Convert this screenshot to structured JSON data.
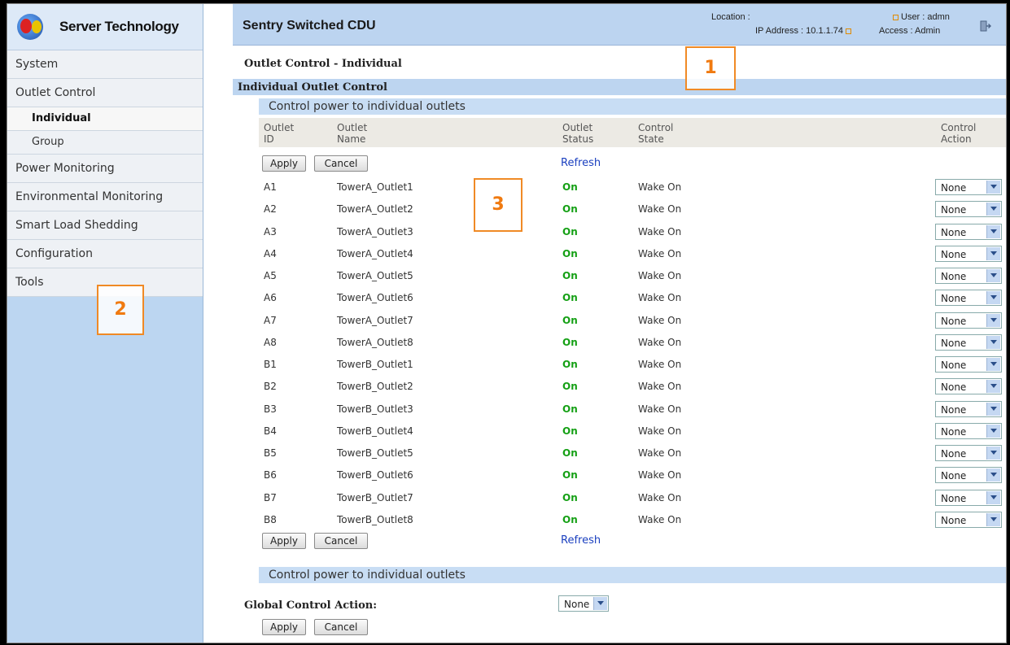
{
  "brand": {
    "name": "Server Technology"
  },
  "nav": {
    "system": "System",
    "outlet_control": "Outlet Control",
    "individual": "Individual",
    "group": "Group",
    "power_monitoring": "Power Monitoring",
    "environmental_monitoring": "Environmental Monitoring",
    "smart_load_shedding": "Smart Load Shedding",
    "configuration": "Configuration",
    "tools": "Tools"
  },
  "header": {
    "title": "Sentry Switched CDU",
    "location_label": "Location :",
    "ip_label": "IP Address : 10.1.1.74",
    "user_label": "User : admn",
    "access_label": "Access : Admin"
  },
  "main": {
    "page_title": "Outlet Control - Individual",
    "section_title": "Individual Outlet Control",
    "subsection": "Control power to individual outlets",
    "columns": {
      "outlet_id_1": "Outlet",
      "outlet_id_2": "ID",
      "outlet_name_1": "Outlet",
      "outlet_name_2": "Name",
      "status_1": "Outlet",
      "status_2": "Status",
      "state_1": "Control",
      "state_2": "State",
      "action_1": "Control",
      "action_2": "Action"
    },
    "apply": "Apply",
    "cancel": "Cancel",
    "refresh": "Refresh",
    "global_label": "Global Control Action:",
    "global_value": "None",
    "subsection2": "Control power to individual outlets"
  },
  "outlets": [
    {
      "id": "A1",
      "name": "TowerA_Outlet1",
      "status": "On",
      "state": "Wake On",
      "action": "None"
    },
    {
      "id": "A2",
      "name": "TowerA_Outlet2",
      "status": "On",
      "state": "Wake On",
      "action": "None"
    },
    {
      "id": "A3",
      "name": "TowerA_Outlet3",
      "status": "On",
      "state": "Wake On",
      "action": "None"
    },
    {
      "id": "A4",
      "name": "TowerA_Outlet4",
      "status": "On",
      "state": "Wake On",
      "action": "None"
    },
    {
      "id": "A5",
      "name": "TowerA_Outlet5",
      "status": "On",
      "state": "Wake On",
      "action": "None"
    },
    {
      "id": "A6",
      "name": "TowerA_Outlet6",
      "status": "On",
      "state": "Wake On",
      "action": "None"
    },
    {
      "id": "A7",
      "name": "TowerA_Outlet7",
      "status": "On",
      "state": "Wake On",
      "action": "None"
    },
    {
      "id": "A8",
      "name": "TowerA_Outlet8",
      "status": "On",
      "state": "Wake On",
      "action": "None"
    },
    {
      "id": "B1",
      "name": "TowerB_Outlet1",
      "status": "On",
      "state": "Wake On",
      "action": "None"
    },
    {
      "id": "B2",
      "name": "TowerB_Outlet2",
      "status": "On",
      "state": "Wake On",
      "action": "None"
    },
    {
      "id": "B3",
      "name": "TowerB_Outlet3",
      "status": "On",
      "state": "Wake On",
      "action": "None"
    },
    {
      "id": "B4",
      "name": "TowerB_Outlet4",
      "status": "On",
      "state": "Wake On",
      "action": "None"
    },
    {
      "id": "B5",
      "name": "TowerB_Outlet5",
      "status": "On",
      "state": "Wake On",
      "action": "None"
    },
    {
      "id": "B6",
      "name": "TowerB_Outlet6",
      "status": "On",
      "state": "Wake On",
      "action": "None"
    },
    {
      "id": "B7",
      "name": "TowerB_Outlet7",
      "status": "On",
      "state": "Wake On",
      "action": "None"
    },
    {
      "id": "B8",
      "name": "TowerB_Outlet8",
      "status": "On",
      "state": "Wake On",
      "action": "None"
    }
  ],
  "markers": {
    "m1": "1",
    "m2": "2",
    "m3": "3"
  },
  "colors": {
    "accent": "#f08a25",
    "status_on": "#15a015",
    "link": "#1a3fbf"
  }
}
